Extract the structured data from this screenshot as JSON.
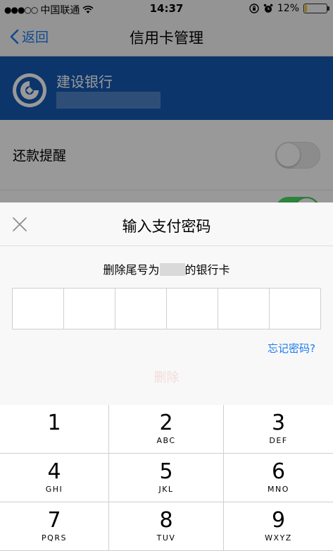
{
  "status_bar": {
    "carrier": "中国联通",
    "time": "14:37",
    "battery": "12%",
    "battery_level": 0.12
  },
  "nav": {
    "back_label": "返回",
    "title": "信用卡管理"
  },
  "card": {
    "bank_name": "建设银行"
  },
  "settings": {
    "items": [
      {
        "label": "还款提醒",
        "enabled": false
      },
      {
        "label": "",
        "enabled": true
      }
    ]
  },
  "payment_sheet": {
    "title": "输入支付密码",
    "desc_prefix": "删除尾号为",
    "desc_suffix": "的银行卡",
    "forgot_label": "忘记密码?",
    "ghost_button": "删除",
    "pin_length": 6
  },
  "keypad": {
    "keys": [
      {
        "digit": "1",
        "letters": ""
      },
      {
        "digit": "2",
        "letters": "ABC"
      },
      {
        "digit": "3",
        "letters": "DEF"
      },
      {
        "digit": "4",
        "letters": "GHI"
      },
      {
        "digit": "5",
        "letters": "JKL"
      },
      {
        "digit": "6",
        "letters": "MNO"
      },
      {
        "digit": "7",
        "letters": "PQRS"
      },
      {
        "digit": "8",
        "letters": "TUV"
      },
      {
        "digit": "9",
        "letters": "WXYZ"
      }
    ]
  },
  "colors": {
    "accent": "#1a7cf0",
    "card_bg": "#1559b3",
    "toggle_on": "#4cd964"
  }
}
